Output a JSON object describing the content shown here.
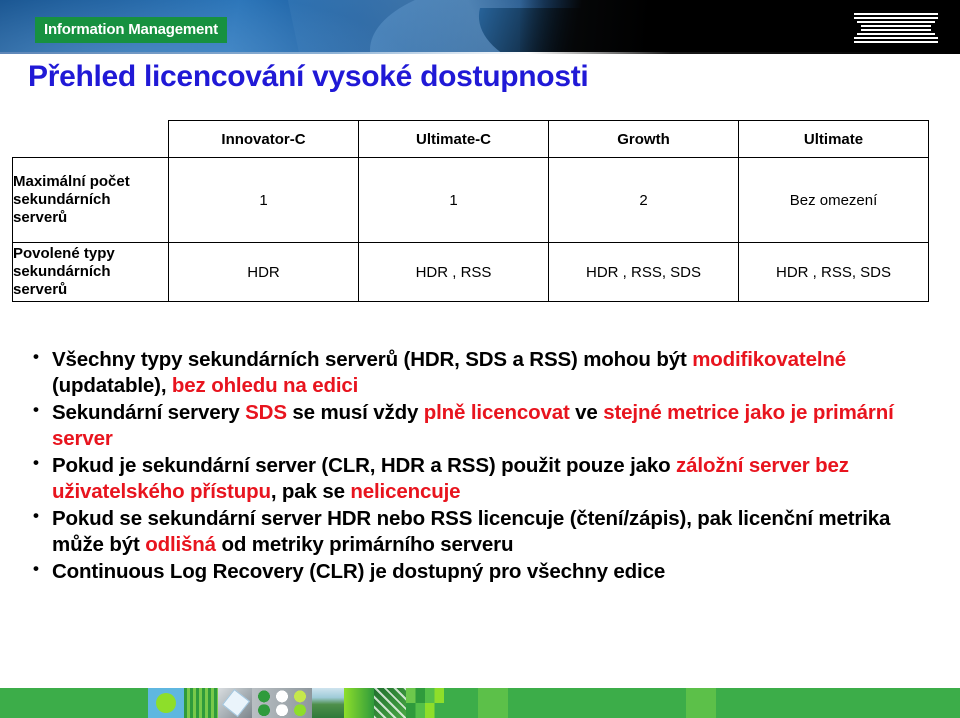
{
  "header": {
    "brand_banner": "Information Management",
    "logo": "IBM"
  },
  "slide": {
    "title": "Přehled licencování vysoké dostupnosti"
  },
  "table": {
    "corner_label": "",
    "columns": [
      {
        "label": "Innovator-C"
      },
      {
        "label": "Ultimate-C"
      },
      {
        "label": "Growth"
      },
      {
        "label": "Ultimate"
      }
    ],
    "rows": [
      {
        "label": "Maximální počet sekundárních serverů",
        "cells": [
          "1",
          "1",
          "2",
          "Bez omezení"
        ]
      },
      {
        "label": "Povolené typy sekundárních serverů",
        "cells": [
          "HDR",
          "HDR , RSS",
          "HDR , RSS, SDS",
          "HDR , RSS, SDS"
        ]
      }
    ]
  },
  "bullets": [
    {
      "parts": [
        {
          "text": "Všechny typy sekundárních serverů (HDR, SDS a RSS) mohou být ",
          "color": "black"
        },
        {
          "text": "modifikovatelné",
          "color": "red"
        },
        {
          "text": " (updatable), ",
          "color": "black"
        },
        {
          "text": "bez ohledu na edici",
          "color": "red"
        }
      ]
    },
    {
      "parts": [
        {
          "text": "Sekundární servery ",
          "color": "black"
        },
        {
          "text": "SDS",
          "color": "red"
        },
        {
          "text": " se musí vždy ",
          "color": "black"
        },
        {
          "text": "plně licencovat",
          "color": "red"
        },
        {
          "text": " ve ",
          "color": "black"
        },
        {
          "text": "stejné metrice jako je primární server",
          "color": "red"
        }
      ]
    },
    {
      "parts": [
        {
          "text": "Pokud je sekundární server (CLR, HDR a RSS) použit pouze jako ",
          "color": "black"
        },
        {
          "text": "záložní server bez uživatelského přístupu",
          "color": "red"
        },
        {
          "text": ", pak se ",
          "color": "black"
        },
        {
          "text": "nelicencuje",
          "color": "red"
        }
      ]
    },
    {
      "parts": [
        {
          "text": "Pokud se sekundární server HDR nebo RSS licencuje (čtení/zápis), pak licenční metrika může být ",
          "color": "black"
        },
        {
          "text": "odlišná",
          "color": "red"
        },
        {
          "text": " od metriky primárního serveru",
          "color": "black"
        }
      ]
    },
    {
      "parts": [
        {
          "text": "Continuous Log Recovery (CLR) je dostupný pro všechny edice",
          "color": "black"
        }
      ]
    }
  ],
  "colors": {
    "title_blue": "#2019d6",
    "highlight_red": "#e8141e",
    "banner_green": "#179140",
    "footer_green": "#3cad49",
    "header_blue": "#1d5f9f"
  }
}
